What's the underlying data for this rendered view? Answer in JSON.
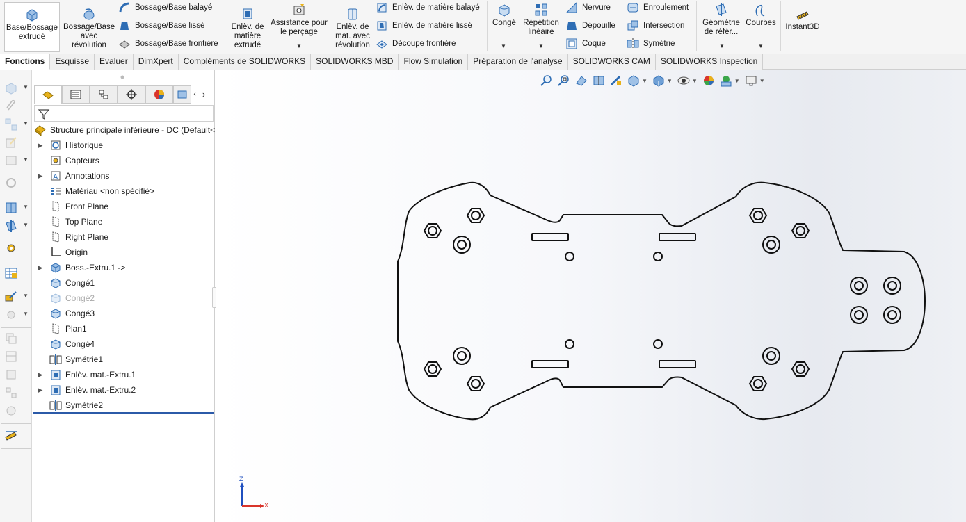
{
  "ribbon": {
    "extrude_boss": "Base/Bossage extrudé",
    "revolve_boss": "Bossage/Base avec révolution",
    "swept_boss": "Bossage/Base balayé",
    "lofted_boss": "Bossage/Base lissé",
    "boundary_boss": "Bossage/Base frontière",
    "extruded_cut": "Enlèv. de matière extrudé",
    "hole_wizard": "Assistance pour le perçage",
    "revolved_cut": "Enlèv. de mat. avec révolution",
    "swept_cut": "Enlèv. de matière balayé",
    "lofted_cut": "Enlèv. de matière lissé",
    "boundary_cut": "Découpe frontière",
    "fillet": "Congé",
    "linear_pattern": "Répétition linéaire",
    "rib": "Nervure",
    "draft": "Dépouille",
    "shell": "Coque",
    "wrap": "Enroulement",
    "intersect": "Intersection",
    "mirror": "Symétrie",
    "ref_geometry": "Géométrie de référ...",
    "curves": "Courbes",
    "instant3d": "Instant3D"
  },
  "tabs": [
    {
      "label": "Fonctions",
      "active": true
    },
    {
      "label": "Esquisse"
    },
    {
      "label": "Evaluer"
    },
    {
      "label": "DimXpert"
    },
    {
      "label": "Compléments de SOLIDWORKS"
    },
    {
      "label": "SOLIDWORKS MBD"
    },
    {
      "label": "Flow Simulation"
    },
    {
      "label": "Préparation de l'analyse"
    },
    {
      "label": "SOLIDWORKS CAM"
    },
    {
      "label": "SOLIDWORKS Inspection"
    }
  ],
  "tree": {
    "root": "Structure principale inférieure - DC  (Default<",
    "items": [
      {
        "label": "Historique",
        "expandable": true,
        "icon": "history-icon"
      },
      {
        "label": "Capteurs",
        "expandable": false,
        "icon": "sensor-icon"
      },
      {
        "label": "Annotations",
        "expandable": true,
        "icon": "annotation-icon"
      },
      {
        "label": "Matériau <non spécifié>",
        "expandable": false,
        "icon": "material-icon"
      },
      {
        "label": "Front Plane",
        "expandable": false,
        "icon": "plane-icon"
      },
      {
        "label": "Top Plane",
        "expandable": false,
        "icon": "plane-icon"
      },
      {
        "label": "Right Plane",
        "expandable": false,
        "icon": "plane-icon"
      },
      {
        "label": "Origin",
        "expandable": false,
        "icon": "origin-icon"
      },
      {
        "label": "Boss.-Extru.1 ->",
        "expandable": true,
        "icon": "extrude-feature-icon"
      },
      {
        "label": "Congé1",
        "expandable": false,
        "icon": "fillet-feature-icon"
      },
      {
        "label": "Congé2",
        "expandable": false,
        "icon": "fillet-feature-icon",
        "suppressed": true
      },
      {
        "label": "Congé3",
        "expandable": false,
        "icon": "fillet-feature-icon"
      },
      {
        "label": "Plan1",
        "expandable": false,
        "icon": "plane-icon"
      },
      {
        "label": "Congé4",
        "expandable": false,
        "icon": "fillet-feature-icon"
      },
      {
        "label": "Symétrie1",
        "expandable": false,
        "icon": "mirror-feature-icon"
      },
      {
        "label": "Enlèv. mat.-Extru.1",
        "expandable": true,
        "icon": "cut-feature-icon"
      },
      {
        "label": "Enlèv. mat.-Extru.2",
        "expandable": true,
        "icon": "cut-feature-icon"
      },
      {
        "label": "Symétrie2",
        "expandable": false,
        "icon": "mirror-feature-icon"
      }
    ]
  },
  "triad": {
    "z": "Z",
    "x": "X"
  },
  "colors": {
    "accent": "#1f5fbf",
    "rollback_bar": "#2b5aa8",
    "icon_blue": "#2e6db4",
    "icon_yellow": "#e8b21a"
  }
}
